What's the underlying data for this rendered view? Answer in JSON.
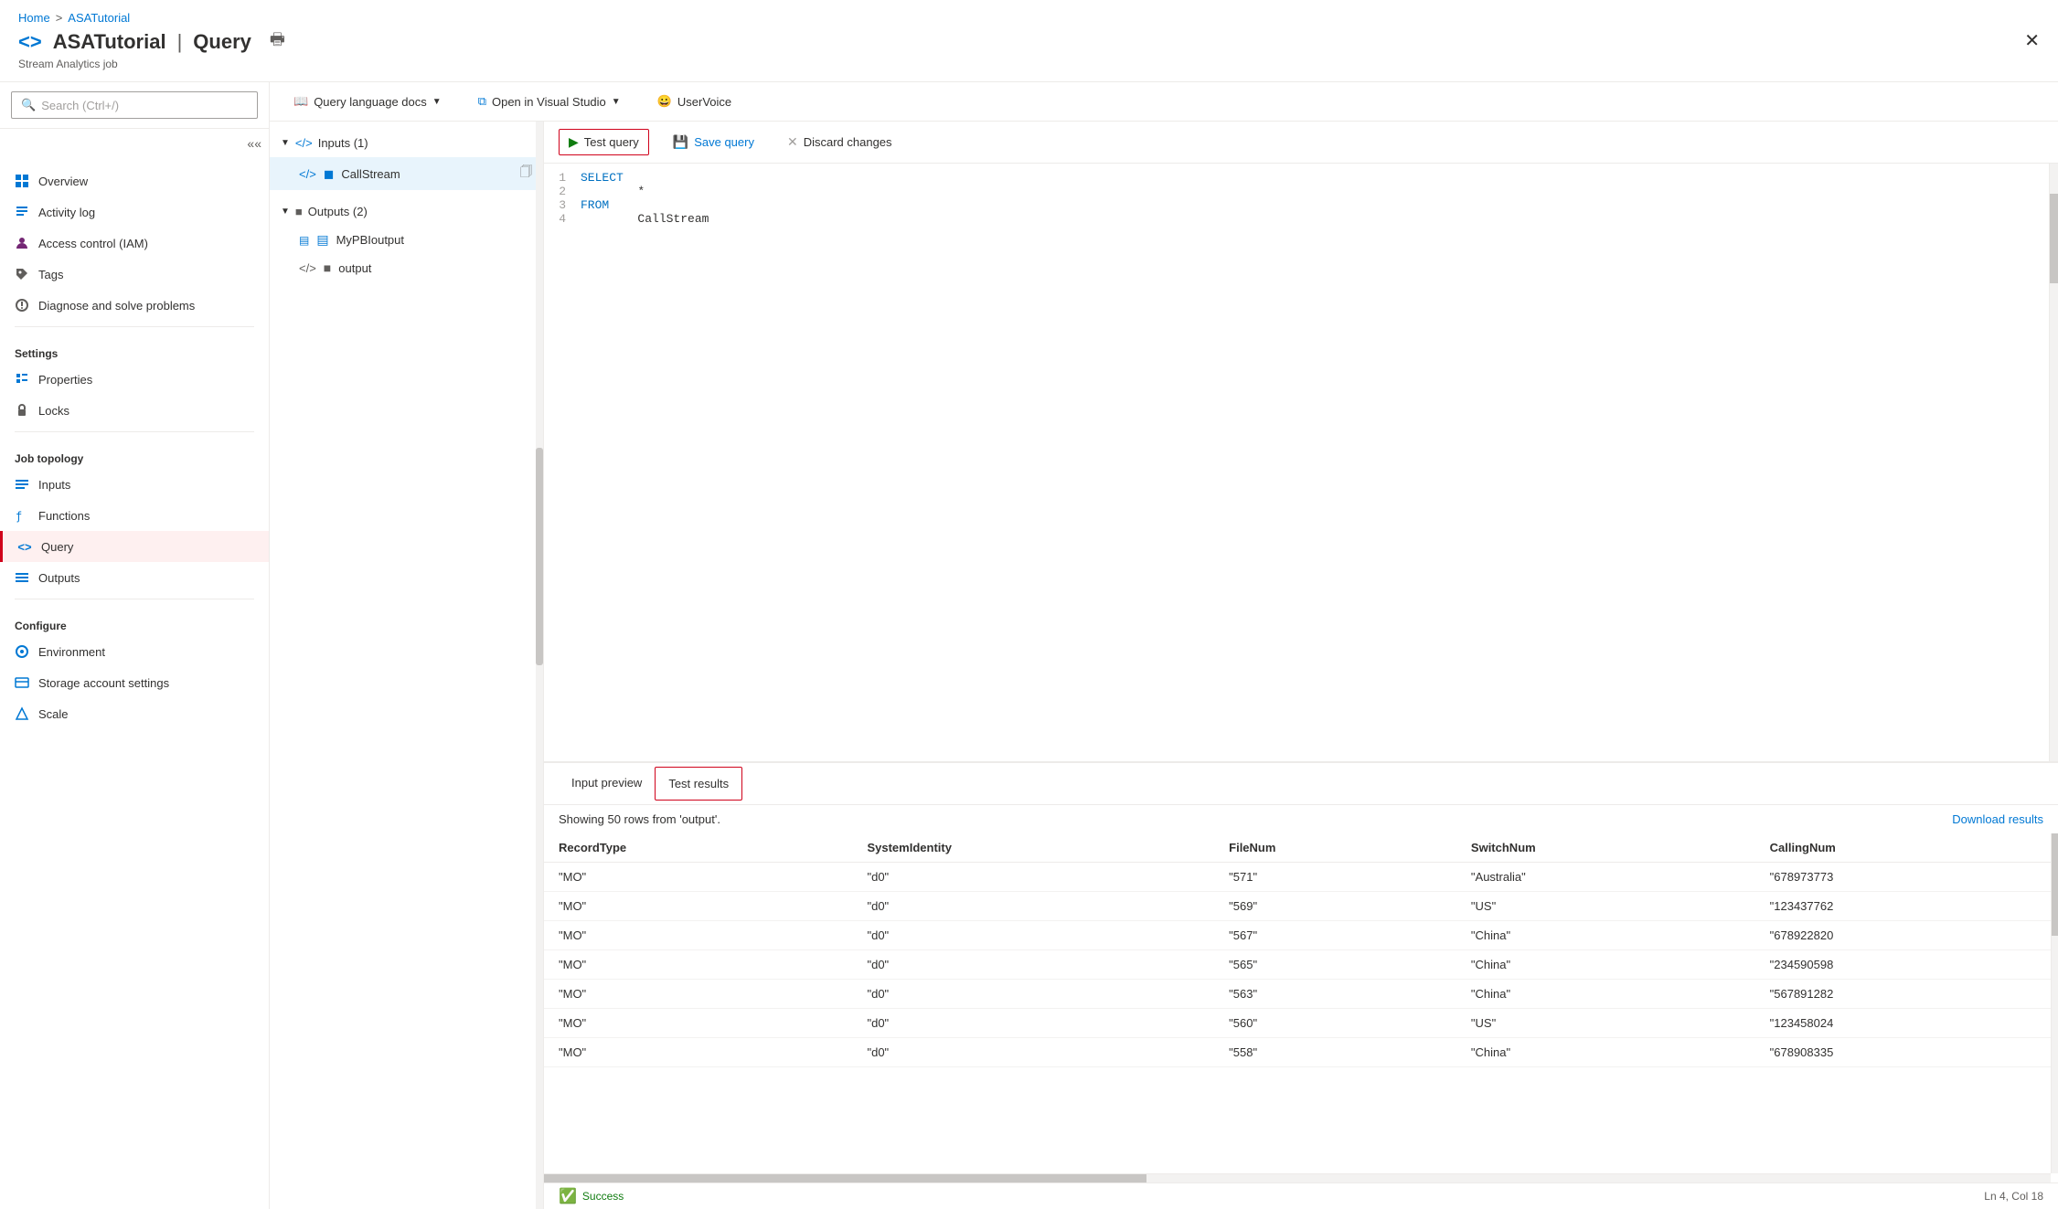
{
  "breadcrumb": {
    "home": "Home",
    "sep": ">",
    "current": "ASATutorial"
  },
  "header": {
    "title": "ASATutorial | Query",
    "subtitle": "Stream Analytics job",
    "title_part1": "ASATutorial",
    "divider": "|",
    "title_part2": "Query"
  },
  "search": {
    "placeholder": "Search (Ctrl+/)"
  },
  "sidebar": {
    "nav_items": [
      {
        "id": "overview",
        "label": "Overview",
        "icon": "chart"
      },
      {
        "id": "activity-log",
        "label": "Activity log",
        "icon": "list"
      },
      {
        "id": "iam",
        "label": "Access control (IAM)",
        "icon": "people"
      },
      {
        "id": "tags",
        "label": "Tags",
        "icon": "tag"
      },
      {
        "id": "diagnose",
        "label": "Diagnose and solve problems",
        "icon": "wrench"
      }
    ],
    "settings_section": "Settings",
    "settings_items": [
      {
        "id": "properties",
        "label": "Properties",
        "icon": "info"
      },
      {
        "id": "locks",
        "label": "Locks",
        "icon": "lock"
      }
    ],
    "job_topology_section": "Job topology",
    "job_topology_items": [
      {
        "id": "inputs",
        "label": "Inputs",
        "icon": "input"
      },
      {
        "id": "functions",
        "label": "Functions",
        "icon": "func"
      },
      {
        "id": "query",
        "label": "Query",
        "icon": "query",
        "active": true
      },
      {
        "id": "outputs",
        "label": "Outputs",
        "icon": "output"
      }
    ],
    "configure_section": "Configure",
    "configure_items": [
      {
        "id": "environment",
        "label": "Environment",
        "icon": "env"
      },
      {
        "id": "storage",
        "label": "Storage account settings",
        "icon": "storage"
      },
      {
        "id": "scale",
        "label": "Scale",
        "icon": "scale"
      }
    ]
  },
  "toolbar": {
    "query_docs_label": "Query language docs",
    "query_docs_dropdown": true,
    "open_vs_label": "Open in Visual Studio",
    "open_vs_dropdown": true,
    "uservoice_label": "UserVoice"
  },
  "io_panel": {
    "inputs_header": "Inputs (1)",
    "inputs": [
      {
        "id": "callstream",
        "label": "CallStream",
        "icon": "code"
      }
    ],
    "outputs_header": "Outputs (2)",
    "outputs": [
      {
        "id": "mypbioutput",
        "label": "MyPBIoutput",
        "icon": "chart"
      },
      {
        "id": "output",
        "label": "output",
        "icon": "output"
      }
    ]
  },
  "action_bar": {
    "test_query": "Test query",
    "save_query": "Save query",
    "discard_changes": "Discard changes"
  },
  "code_editor": {
    "lines": [
      {
        "num": "1",
        "content_text": "SELECT",
        "type": "keyword"
      },
      {
        "num": "2",
        "content_text": "        *",
        "type": "star"
      },
      {
        "num": "3",
        "content_text": "FROM",
        "type": "keyword"
      },
      {
        "num": "4",
        "content_text": "        CallStream",
        "type": "text"
      }
    ]
  },
  "results": {
    "tab_input_preview": "Input preview",
    "tab_test_results": "Test results",
    "active_tab": "test_results",
    "showing_text": "Showing 50 rows from 'output'.",
    "download_label": "Download results",
    "columns": [
      "RecordType",
      "SystemIdentity",
      "FileNum",
      "SwitchNum",
      "CallingNum"
    ],
    "rows": [
      [
        "\"MO\"",
        "\"d0\"",
        "\"571\"",
        "\"Australia\"",
        "\"678973773"
      ],
      [
        "\"MO\"",
        "\"d0\"",
        "\"569\"",
        "\"US\"",
        "\"123437762"
      ],
      [
        "\"MO\"",
        "\"d0\"",
        "\"567\"",
        "\"China\"",
        "\"678922820"
      ],
      [
        "\"MO\"",
        "\"d0\"",
        "\"565\"",
        "\"China\"",
        "\"234590598"
      ],
      [
        "\"MO\"",
        "\"d0\"",
        "\"563\"",
        "\"China\"",
        "\"567891282"
      ],
      [
        "\"MO\"",
        "\"d0\"",
        "\"560\"",
        "\"US\"",
        "\"123458024"
      ],
      [
        "\"MO\"",
        "\"d0\"",
        "\"558\"",
        "\"China\"",
        "\"678908335"
      ]
    ]
  },
  "status_bar": {
    "success_text": "Success",
    "position_text": "Ln 4, Col 18"
  }
}
